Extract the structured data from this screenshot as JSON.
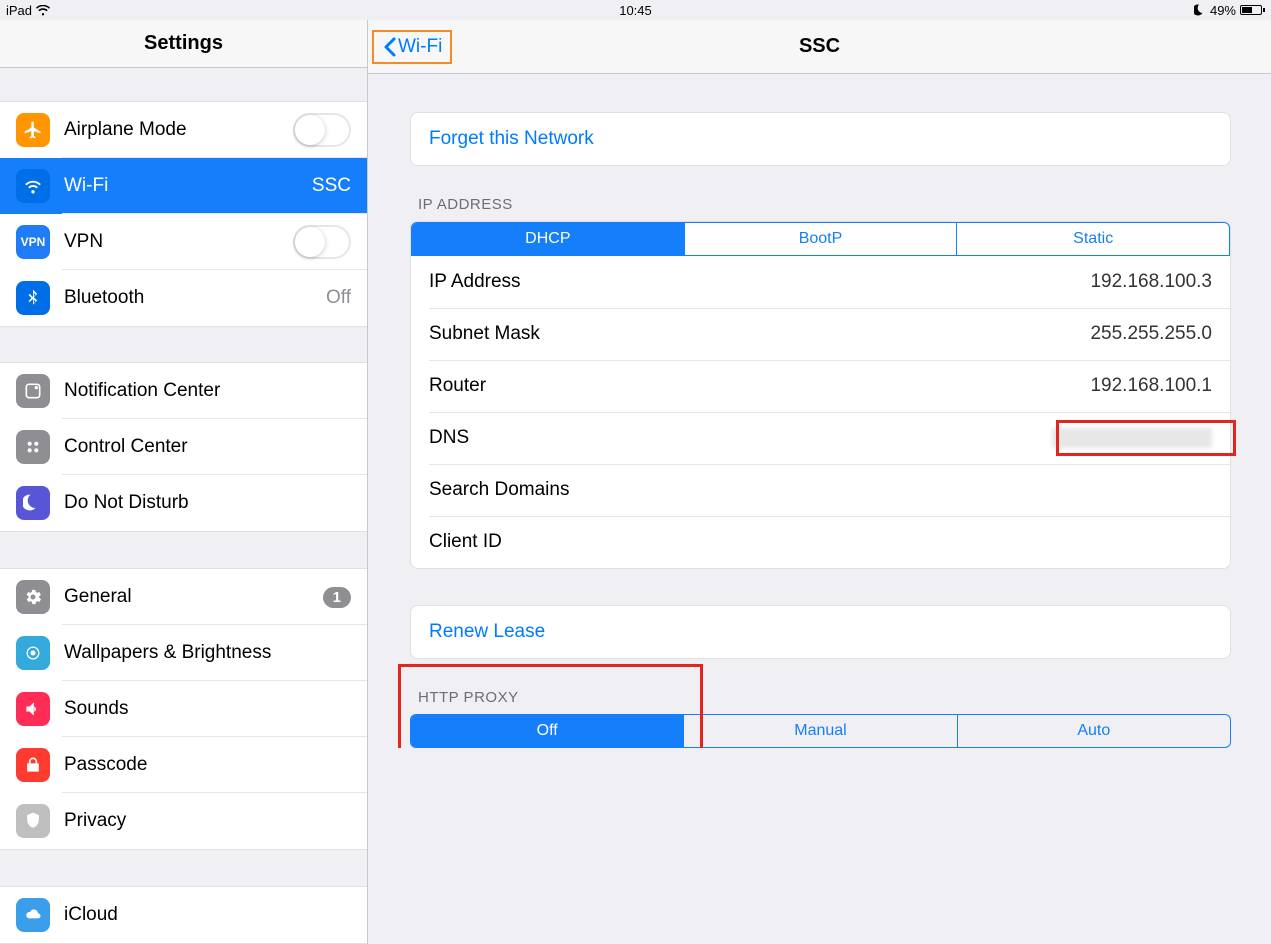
{
  "status": {
    "device": "iPad",
    "time": "10:45",
    "battery": "49%"
  },
  "sidebar": {
    "title": "Settings",
    "g1": {
      "airplane": "Airplane Mode",
      "wifi": "Wi-Fi",
      "wifi_val": "SSC",
      "vpn": "VPN",
      "bluetooth": "Bluetooth",
      "bluetooth_val": "Off"
    },
    "g2": {
      "notif": "Notification Center",
      "control": "Control Center",
      "dnd": "Do Not Disturb"
    },
    "g3": {
      "general": "General",
      "general_badge": "1",
      "wallpaper": "Wallpapers & Brightness",
      "sounds": "Sounds",
      "passcode": "Passcode",
      "privacy": "Privacy"
    },
    "g4": {
      "icloud": "iCloud"
    }
  },
  "detail": {
    "back": "Wi-Fi",
    "title": "SSC",
    "forget": "Forget this Network",
    "ip_section": "IP ADDRESS",
    "seg_ip": {
      "dhcp": "DHCP",
      "bootp": "BootP",
      "static": "Static"
    },
    "rows": {
      "ip_k": "IP Address",
      "ip_v": "192.168.100.3",
      "subnet_k": "Subnet Mask",
      "subnet_v": "255.255.255.0",
      "router_k": "Router",
      "router_v": "192.168.100.1",
      "dns_k": "DNS",
      "search_k": "Search Domains",
      "client_k": "Client ID"
    },
    "renew": "Renew Lease",
    "proxy_section": "HTTP PROXY",
    "seg_proxy": {
      "off": "Off",
      "manual": "Manual",
      "auto": "Auto"
    }
  }
}
